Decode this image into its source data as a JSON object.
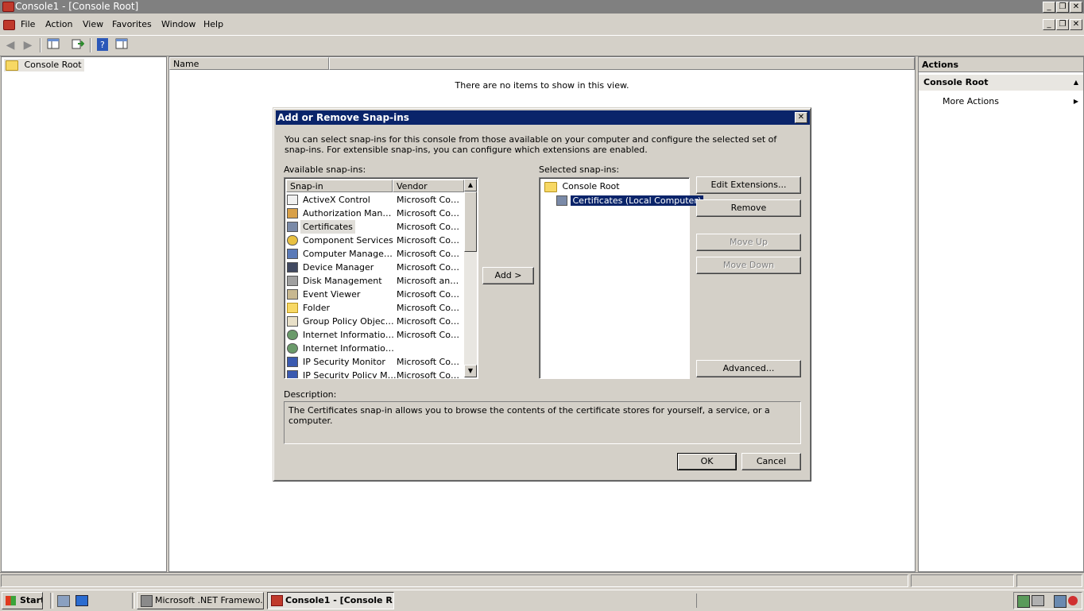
{
  "window": {
    "title": "Console1 - [Console Root]"
  },
  "menu": [
    "File",
    "Action",
    "View",
    "Favorites",
    "Window",
    "Help"
  ],
  "tree": {
    "root_label": "Console Root"
  },
  "center": {
    "column_name": "Name",
    "empty_message": "There are no items to show in this view."
  },
  "actions": {
    "header": "Actions",
    "section": "Console Root",
    "more_actions": "More Actions"
  },
  "dialog": {
    "title": "Add or Remove Snap-ins",
    "intro": "You can select snap-ins for this console from those available on your computer and configure the selected set of snap-ins. For extensible snap-ins, you can configure which extensions are enabled.",
    "available_label": "Available snap-ins:",
    "selected_label": "Selected snap-ins:",
    "col_snapin": "Snap-in",
    "col_vendor": "Vendor",
    "available": [
      {
        "name": "ActiveX Control",
        "vendor": "Microsoft Cor...",
        "icon": "activex-icon"
      },
      {
        "name": "Authorization Manager",
        "vendor": "Microsoft Cor...",
        "icon": "authorization-icon"
      },
      {
        "name": "Certificates",
        "vendor": "Microsoft Cor...",
        "icon": "certificate-icon"
      },
      {
        "name": "Component Services",
        "vendor": "Microsoft Cor...",
        "icon": "component-services-icon"
      },
      {
        "name": "Computer Managem...",
        "vendor": "Microsoft Cor...",
        "icon": "computer-management-icon"
      },
      {
        "name": "Device Manager",
        "vendor": "Microsoft Cor...",
        "icon": "device-manager-icon"
      },
      {
        "name": "Disk Management",
        "vendor": "Microsoft and...",
        "icon": "disk-icon"
      },
      {
        "name": "Event Viewer",
        "vendor": "Microsoft Cor...",
        "icon": "event-viewer-icon"
      },
      {
        "name": "Folder",
        "vendor": "Microsoft Cor...",
        "icon": "folder-icon"
      },
      {
        "name": "Group Policy Object ...",
        "vendor": "Microsoft Cor...",
        "icon": "group-policy-icon"
      },
      {
        "name": "Internet Information...",
        "vendor": "Microsoft Cor...",
        "icon": "iis-icon"
      },
      {
        "name": "Internet Information...",
        "vendor": "",
        "icon": "iis-icon"
      },
      {
        "name": "IP Security Monitor",
        "vendor": "Microsoft Cor...",
        "icon": "ip-security-icon"
      },
      {
        "name": "IP Security Policy Ma...",
        "vendor": "Microsoft Cor...",
        "icon": "ip-security-policy-icon"
      }
    ],
    "selected_tree": {
      "root": "Console Root",
      "child": "Certificates (Local Computer)"
    },
    "add_button": "Add >",
    "edit_extensions": "Edit Extensions...",
    "remove": "Remove",
    "move_up": "Move Up",
    "move_down": "Move Down",
    "advanced": "Advanced...",
    "description_label": "Description:",
    "description": "The Certificates snap-in allows you to browse the contents of the certificate stores for yourself, a service, or a computer.",
    "ok": "OK",
    "cancel": "Cancel"
  },
  "taskbar": {
    "start": "Start",
    "tasks": [
      "Microsoft .NET Framewo...",
      "Console1 - [Console R..."
    ]
  }
}
